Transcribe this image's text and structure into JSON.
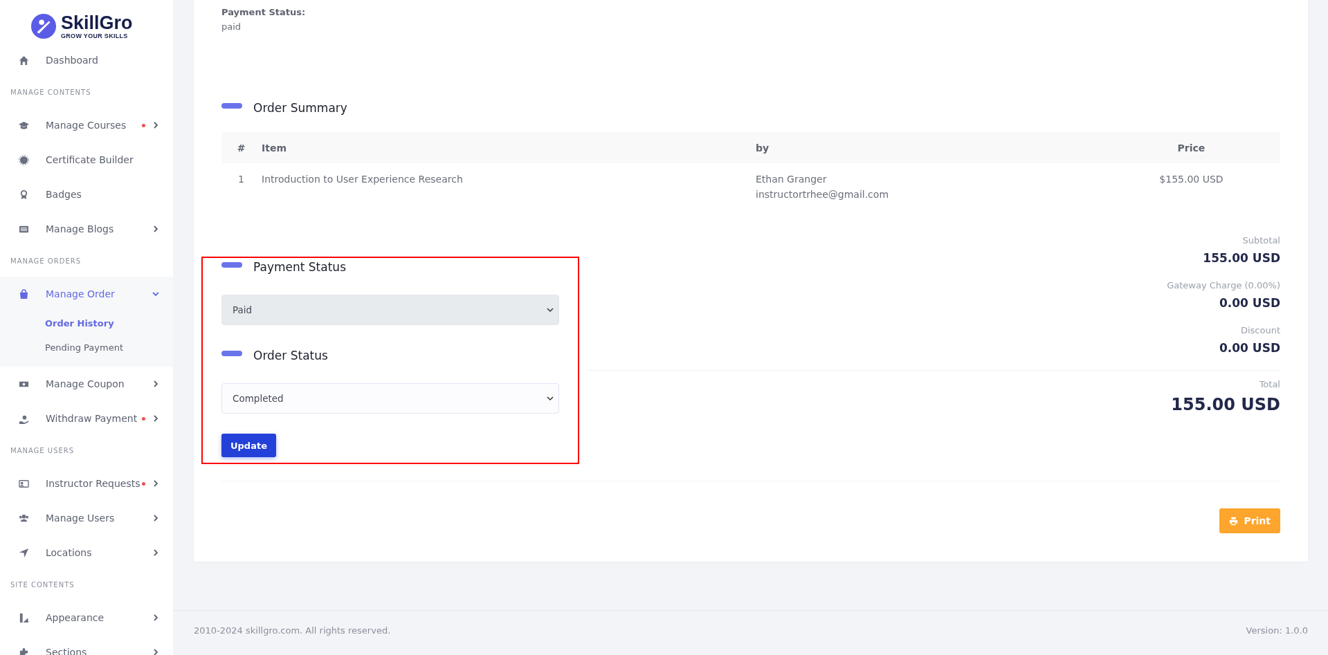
{
  "sidebar": {
    "logo": {
      "name": "SkillGro",
      "tagline": "GROW YOUR SKILLS"
    },
    "sections": [
      {
        "items": [
          {
            "label": "Dashboard",
            "dot": false,
            "expandable": false,
            "selected": false
          }
        ]
      },
      {
        "heading": "MANAGE CONTENTS",
        "items": [
          {
            "label": "Manage Courses",
            "dot": true,
            "expandable": true,
            "expanded": false,
            "selected": false
          },
          {
            "label": "Certificate Builder",
            "dot": false,
            "expandable": false,
            "selected": false
          },
          {
            "label": "Badges",
            "dot": false,
            "expandable": false,
            "selected": false
          },
          {
            "label": "Manage Blogs",
            "dot": false,
            "expandable": true,
            "expanded": false,
            "selected": false
          }
        ]
      },
      {
        "heading": "MANAGE ORDERS",
        "items": [
          {
            "label": "Manage Order",
            "dot": false,
            "expandable": true,
            "expanded": true,
            "selected": true,
            "children": [
              {
                "label": "Order History",
                "selected": true
              },
              {
                "label": "Pending Payment",
                "selected": false
              }
            ]
          },
          {
            "label": "Manage Coupon",
            "dot": false,
            "expandable": true,
            "expanded": false,
            "selected": false
          },
          {
            "label": "Withdraw Payment",
            "dot": true,
            "expandable": true,
            "expanded": false,
            "selected": false
          }
        ]
      },
      {
        "heading": "MANAGE USERS",
        "items": [
          {
            "label": "Instructor Requests",
            "dot": true,
            "expandable": true,
            "expanded": false,
            "selected": false
          },
          {
            "label": "Manage Users",
            "dot": false,
            "expandable": true,
            "expanded": false,
            "selected": false
          },
          {
            "label": "Locations",
            "dot": false,
            "expandable": true,
            "expanded": false,
            "selected": false
          }
        ]
      },
      {
        "heading": "SITE CONTENTS",
        "items": [
          {
            "label": "Appearance",
            "dot": false,
            "expandable": true,
            "expanded": false,
            "selected": false
          },
          {
            "label": "Sections",
            "dot": false,
            "expandable": true,
            "expanded": false,
            "selected": false
          }
        ]
      }
    ]
  },
  "payment_info": {
    "label": "Payment Status:",
    "value": "paid"
  },
  "order_summary": {
    "title": "Order Summary",
    "columns": [
      "#",
      "Item",
      "by",
      "Price"
    ],
    "rows": [
      {
        "number": "1",
        "item": "Introduction to User Experience Research",
        "by_name": "Ethan Granger",
        "by_email": "instructortrhee@gmail.com",
        "price": "$155.00 USD"
      }
    ]
  },
  "payment_status": {
    "title": "Payment Status",
    "value": "Paid",
    "disabled": true
  },
  "order_status": {
    "title": "Order Status",
    "value": "Completed",
    "disabled": false
  },
  "update_button": "Update",
  "totals": [
    {
      "kind": "line",
      "label": "Subtotal",
      "value": "155.00 USD"
    },
    {
      "kind": "line",
      "label": "Gateway Charge (0.00%)",
      "value": "0.00 USD"
    },
    {
      "kind": "line",
      "label": "Discount",
      "value": "0.00 USD"
    },
    {
      "kind": "total",
      "label": "Total",
      "value": "155.00 USD"
    }
  ],
  "print_button": "Print",
  "footer": {
    "copyright": "2010-2024 skillgro.com. All rights reserved.",
    "version": "Version: 1.0.0"
  }
}
